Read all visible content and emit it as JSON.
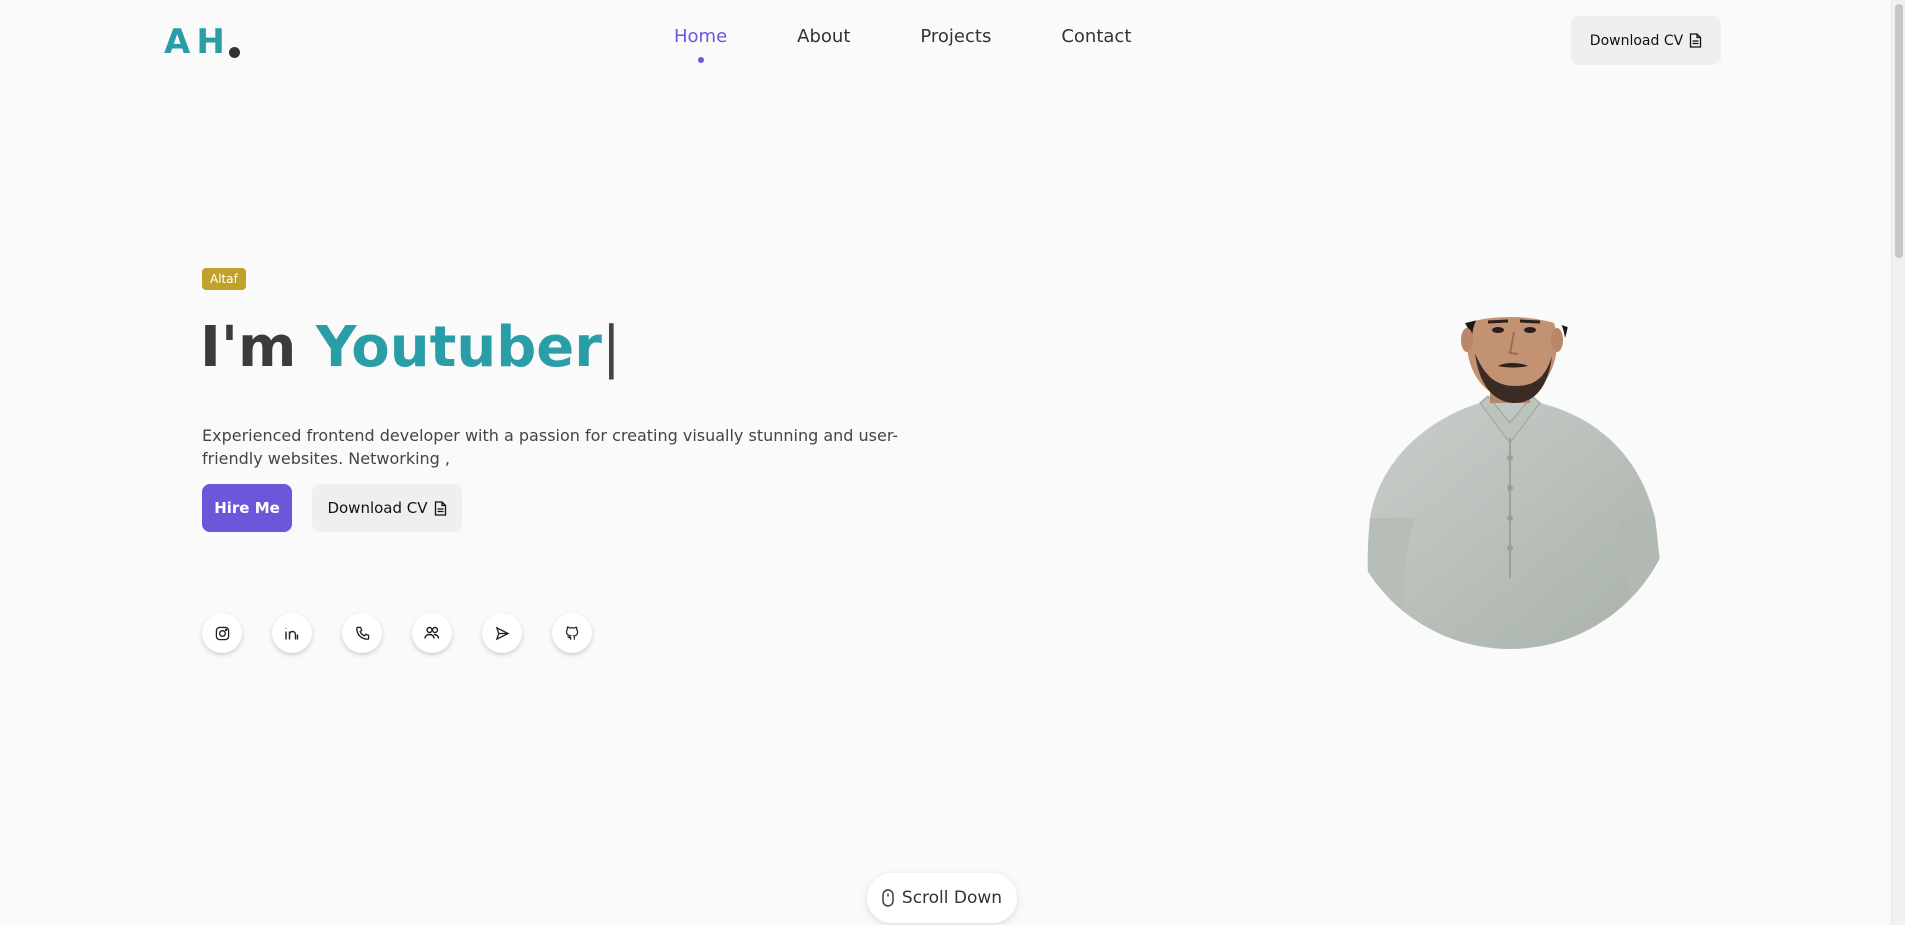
{
  "header": {
    "logo_text": "AH",
    "nav": [
      {
        "label": "Home",
        "active": true
      },
      {
        "label": "About",
        "active": false
      },
      {
        "label": "Projects",
        "active": false
      },
      {
        "label": "Contact",
        "active": false
      }
    ],
    "download_cv_label": "Download CV"
  },
  "hero": {
    "badge": "Altaf",
    "headline_prefix": "I'm ",
    "headline_role": "Youtuber",
    "headline_cursor": "|",
    "description": "Experienced frontend developer with a passion for creating visually stunning and user-friendly websites. Networking ,",
    "hire_label": "Hire Me",
    "download_cv_label": "Download CV",
    "socials": [
      {
        "icon": "instagram-icon"
      },
      {
        "icon": "linkedin-icon"
      },
      {
        "icon": "phone-icon"
      },
      {
        "icon": "users-icon"
      },
      {
        "icon": "send-icon"
      },
      {
        "icon": "github-icon"
      }
    ]
  },
  "scroll": {
    "label": "Scroll Down",
    "icon": "mouse-icon"
  },
  "colors": {
    "accent_teal": "#2a9ea6",
    "accent_purple": "#6a57d9",
    "badge_gold": "#c0a22a",
    "background": "#fafafa"
  }
}
